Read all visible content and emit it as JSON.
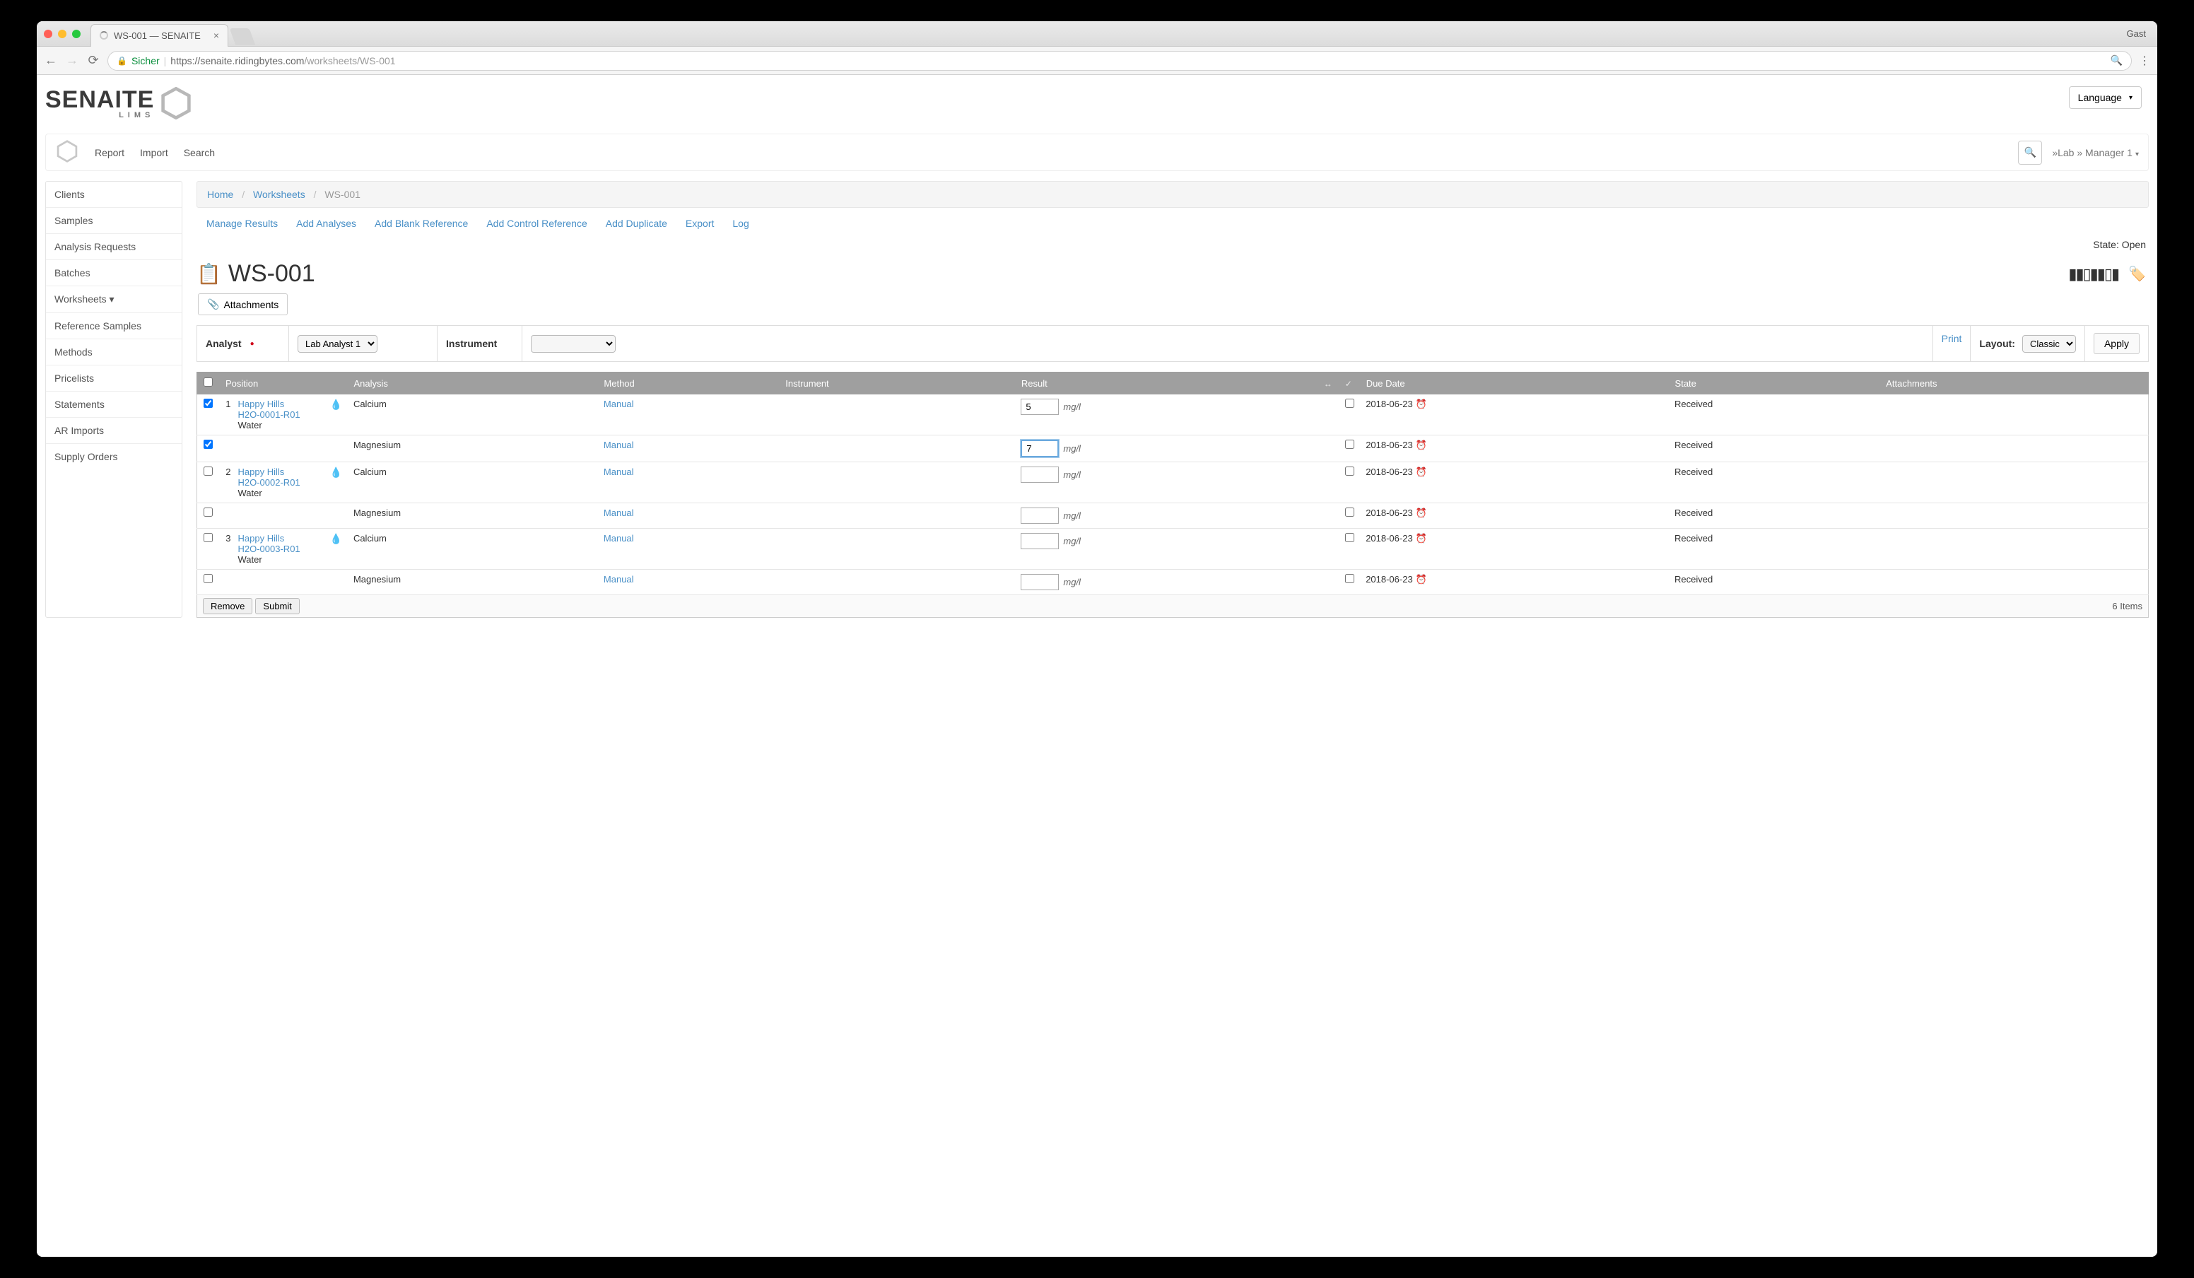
{
  "browser": {
    "tab_title": "WS-001 — SENAITE",
    "guest": "Gast",
    "secure": "Sicher",
    "url_prefix": "https://",
    "url_host": "senaite.ridingbytes.com",
    "url_path": "/worksheets/WS-001"
  },
  "logo": {
    "name": "SENAITE",
    "sub": "LIMS"
  },
  "language_btn": "Language",
  "appbar": {
    "report": "Report",
    "import": "Import",
    "search": "Search",
    "user": "»Lab » Manager 1"
  },
  "sidebar": {
    "items": [
      "Clients",
      "Samples",
      "Analysis Requests",
      "Batches",
      "Worksheets ▾",
      "Reference Samples",
      "Methods",
      "Pricelists",
      "Statements",
      "AR Imports",
      "Supply Orders"
    ]
  },
  "breadcrumb": {
    "home": "Home",
    "worksheets": "Worksheets",
    "current": "WS-001"
  },
  "tabs": {
    "manage": "Manage Results",
    "add_analyses": "Add Analyses",
    "add_blank": "Add Blank Reference",
    "add_control": "Add Control Reference",
    "add_dup": "Add Duplicate",
    "export": "Export",
    "log": "Log"
  },
  "state_label": "State:",
  "state_value": "Open",
  "page_title": "WS-001",
  "attachments_btn": "Attachments",
  "params": {
    "analyst_label": "Analyst",
    "analyst_value": "Lab Analyst 1",
    "instrument_label": "Instrument",
    "instrument_value": "",
    "print": "Print",
    "layout_label": "Layout:",
    "layout_value": "Classic",
    "apply": "Apply"
  },
  "columns": {
    "position": "Position",
    "analysis": "Analysis",
    "method": "Method",
    "instrument": "Instrument",
    "result": "Result",
    "due": "Due Date",
    "state": "State",
    "attachments": "Attachments"
  },
  "rows": [
    {
      "pos": "1",
      "client": "Happy Hills",
      "req": "H2O-0001-R01",
      "type": "Water",
      "analysis": "Calcium",
      "method": "Manual",
      "result": "5",
      "unit": "mg/l",
      "checked": true,
      "due": "2018-06-23",
      "state": "Received"
    },
    {
      "analysis": "Magnesium",
      "method": "Manual",
      "result": "7",
      "unit": "mg/l",
      "checked": true,
      "active": true,
      "due": "2018-06-23",
      "state": "Received"
    },
    {
      "pos": "2",
      "client": "Happy Hills",
      "req": "H2O-0002-R01",
      "type": "Water",
      "analysis": "Calcium",
      "method": "Manual",
      "result": "",
      "unit": "mg/l",
      "due": "2018-06-23",
      "state": "Received"
    },
    {
      "analysis": "Magnesium",
      "method": "Manual",
      "result": "",
      "unit": "mg/l",
      "due": "2018-06-23",
      "state": "Received"
    },
    {
      "pos": "3",
      "client": "Happy Hills",
      "req": "H2O-0003-R01",
      "type": "Water",
      "analysis": "Calcium",
      "method": "Manual",
      "result": "",
      "unit": "mg/l",
      "due": "2018-06-23",
      "state": "Received"
    },
    {
      "analysis": "Magnesium",
      "method": "Manual",
      "result": "",
      "unit": "mg/l",
      "due": "2018-06-23",
      "state": "Received"
    }
  ],
  "footer": {
    "remove": "Remove",
    "submit": "Submit",
    "count": "6 Items"
  }
}
